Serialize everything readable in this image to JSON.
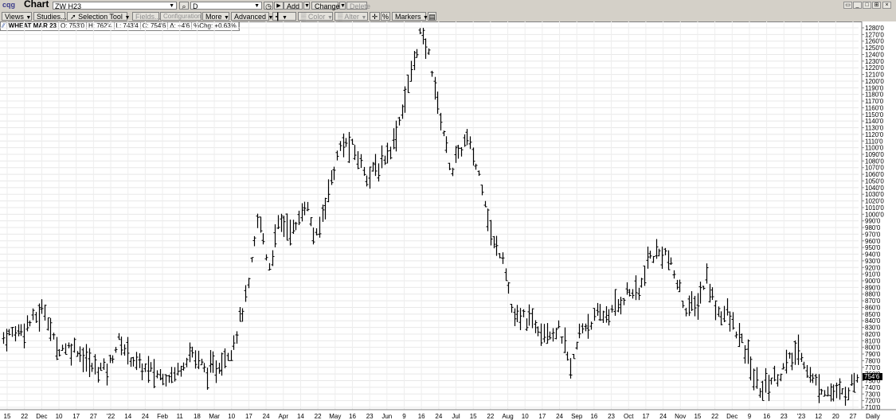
{
  "app": {
    "logo_text": "cqg",
    "title": "Chart",
    "symbol": "ZW H23",
    "period": "D"
  },
  "toolbar": {
    "views": "Views",
    "studies": "Studies...",
    "selection_tool": "Selection Tool",
    "fields": "Fields...",
    "configuration": "Configuration",
    "more": "More",
    "advanced": "Advanced",
    "color": "Color",
    "alter": "Alter",
    "percent": "%",
    "markers": "Markers",
    "add": "Add",
    "change": "Change",
    "delete": "Delete"
  },
  "info": {
    "name": "WHEAT MAR 23",
    "open": "O: 753'0",
    "high": "H: 762'4",
    "low": "L: 743'4",
    "close": "C: 754'6",
    "delta": "Δ: +4'6",
    "pct_change": "%Chg: +0.63%"
  },
  "chart_data": {
    "type": "ohlc",
    "price_tag": "754'6",
    "y_labels": [
      "1280'0",
      "1270'0",
      "1260'0",
      "1250'0",
      "1240'0",
      "1230'0",
      "1220'0",
      "1210'0",
      "1200'0",
      "1190'0",
      "1180'0",
      "1170'0",
      "1160'0",
      "1150'0",
      "1140'0",
      "1130'0",
      "1120'0",
      "1110'0",
      "1100'0",
      "1090'0",
      "1080'0",
      "1070'0",
      "1060'0",
      "1050'0",
      "1040'0",
      "1030'0",
      "1020'0",
      "1010'0",
      "1000'0",
      "990'0",
      "980'0",
      "970'0",
      "960'0",
      "950'0",
      "940'0",
      "930'0",
      "920'0",
      "910'0",
      "900'0",
      "890'0",
      "880'0",
      "870'0",
      "860'0",
      "850'0",
      "840'0",
      "830'0",
      "820'0",
      "810'0",
      "800'0",
      "790'0",
      "780'0",
      "770'0",
      "760'0",
      "750'0",
      "740'0",
      "730'0",
      "720'0",
      "710'0"
    ],
    "x_labels": [
      "15",
      "22",
      "Dec",
      "10",
      "17",
      "27",
      "'22",
      "14",
      "24",
      "Feb",
      "11",
      "18",
      "Mar",
      "10",
      "17",
      "24",
      "Apr",
      "14",
      "22",
      "May",
      "16",
      "23",
      "Jun",
      "9",
      "16",
      "24",
      "Jul",
      "15",
      "22",
      "Aug",
      "10",
      "17",
      "24",
      "Sep",
      "16",
      "23",
      "Oct",
      "17",
      "24",
      "Nov",
      "15",
      "22",
      "Dec",
      "9",
      "16",
      "23",
      "'23",
      "12",
      "20",
      "27"
    ],
    "x_axis_label": "Daily",
    "ylim": [
      710,
      1280
    ],
    "price_path": [
      [
        0,
        815
      ],
      [
        4,
        830
      ],
      [
        8,
        858
      ],
      [
        10,
        800
      ],
      [
        14,
        800
      ],
      [
        17,
        770
      ],
      [
        20,
        768
      ],
      [
        22,
        810
      ],
      [
        26,
        772
      ],
      [
        30,
        758
      ],
      [
        33,
        760
      ],
      [
        36,
        795
      ],
      [
        39,
        763
      ],
      [
        41,
        770
      ],
      [
        44,
        802
      ],
      [
        47,
        885
      ],
      [
        49,
        1000
      ],
      [
        51,
        920
      ],
      [
        53,
        990
      ],
      [
        56,
        975
      ],
      [
        58,
        1020
      ],
      [
        60,
        958
      ],
      [
        62,
        1025
      ],
      [
        65,
        1108
      ],
      [
        67,
        1100
      ],
      [
        70,
        1058
      ],
      [
        72,
        1070
      ],
      [
        75,
        1110
      ],
      [
        78,
        1200
      ],
      [
        80,
        1270
      ],
      [
        82,
        1235
      ],
      [
        83,
        1180
      ],
      [
        84,
        1145
      ],
      [
        86,
        1065
      ],
      [
        88,
        1100
      ],
      [
        89,
        1115
      ],
      [
        92,
        1045
      ],
      [
        94,
        955
      ],
      [
        96,
        940
      ],
      [
        98,
        840
      ],
      [
        100,
        845
      ],
      [
        103,
        832
      ],
      [
        105,
        825
      ],
      [
        107,
        825
      ],
      [
        109,
        765
      ],
      [
        111,
        830
      ],
      [
        114,
        845
      ],
      [
        117,
        853
      ],
      [
        120,
        885
      ],
      [
        122,
        880
      ],
      [
        124,
        935
      ],
      [
        127,
        945
      ],
      [
        129,
        905
      ],
      [
        131,
        860
      ],
      [
        133,
        860
      ],
      [
        135,
        905
      ],
      [
        137,
        855
      ],
      [
        139,
        850
      ],
      [
        141,
        820
      ],
      [
        143,
        785
      ],
      [
        145,
        735
      ],
      [
        147,
        748
      ],
      [
        149,
        760
      ],
      [
        151,
        780
      ],
      [
        153,
        795
      ],
      [
        155,
        755
      ],
      [
        157,
        740
      ],
      [
        159,
        733
      ],
      [
        161,
        728
      ],
      [
        163,
        745
      ],
      [
        164,
        758
      ]
    ],
    "grid": true
  }
}
